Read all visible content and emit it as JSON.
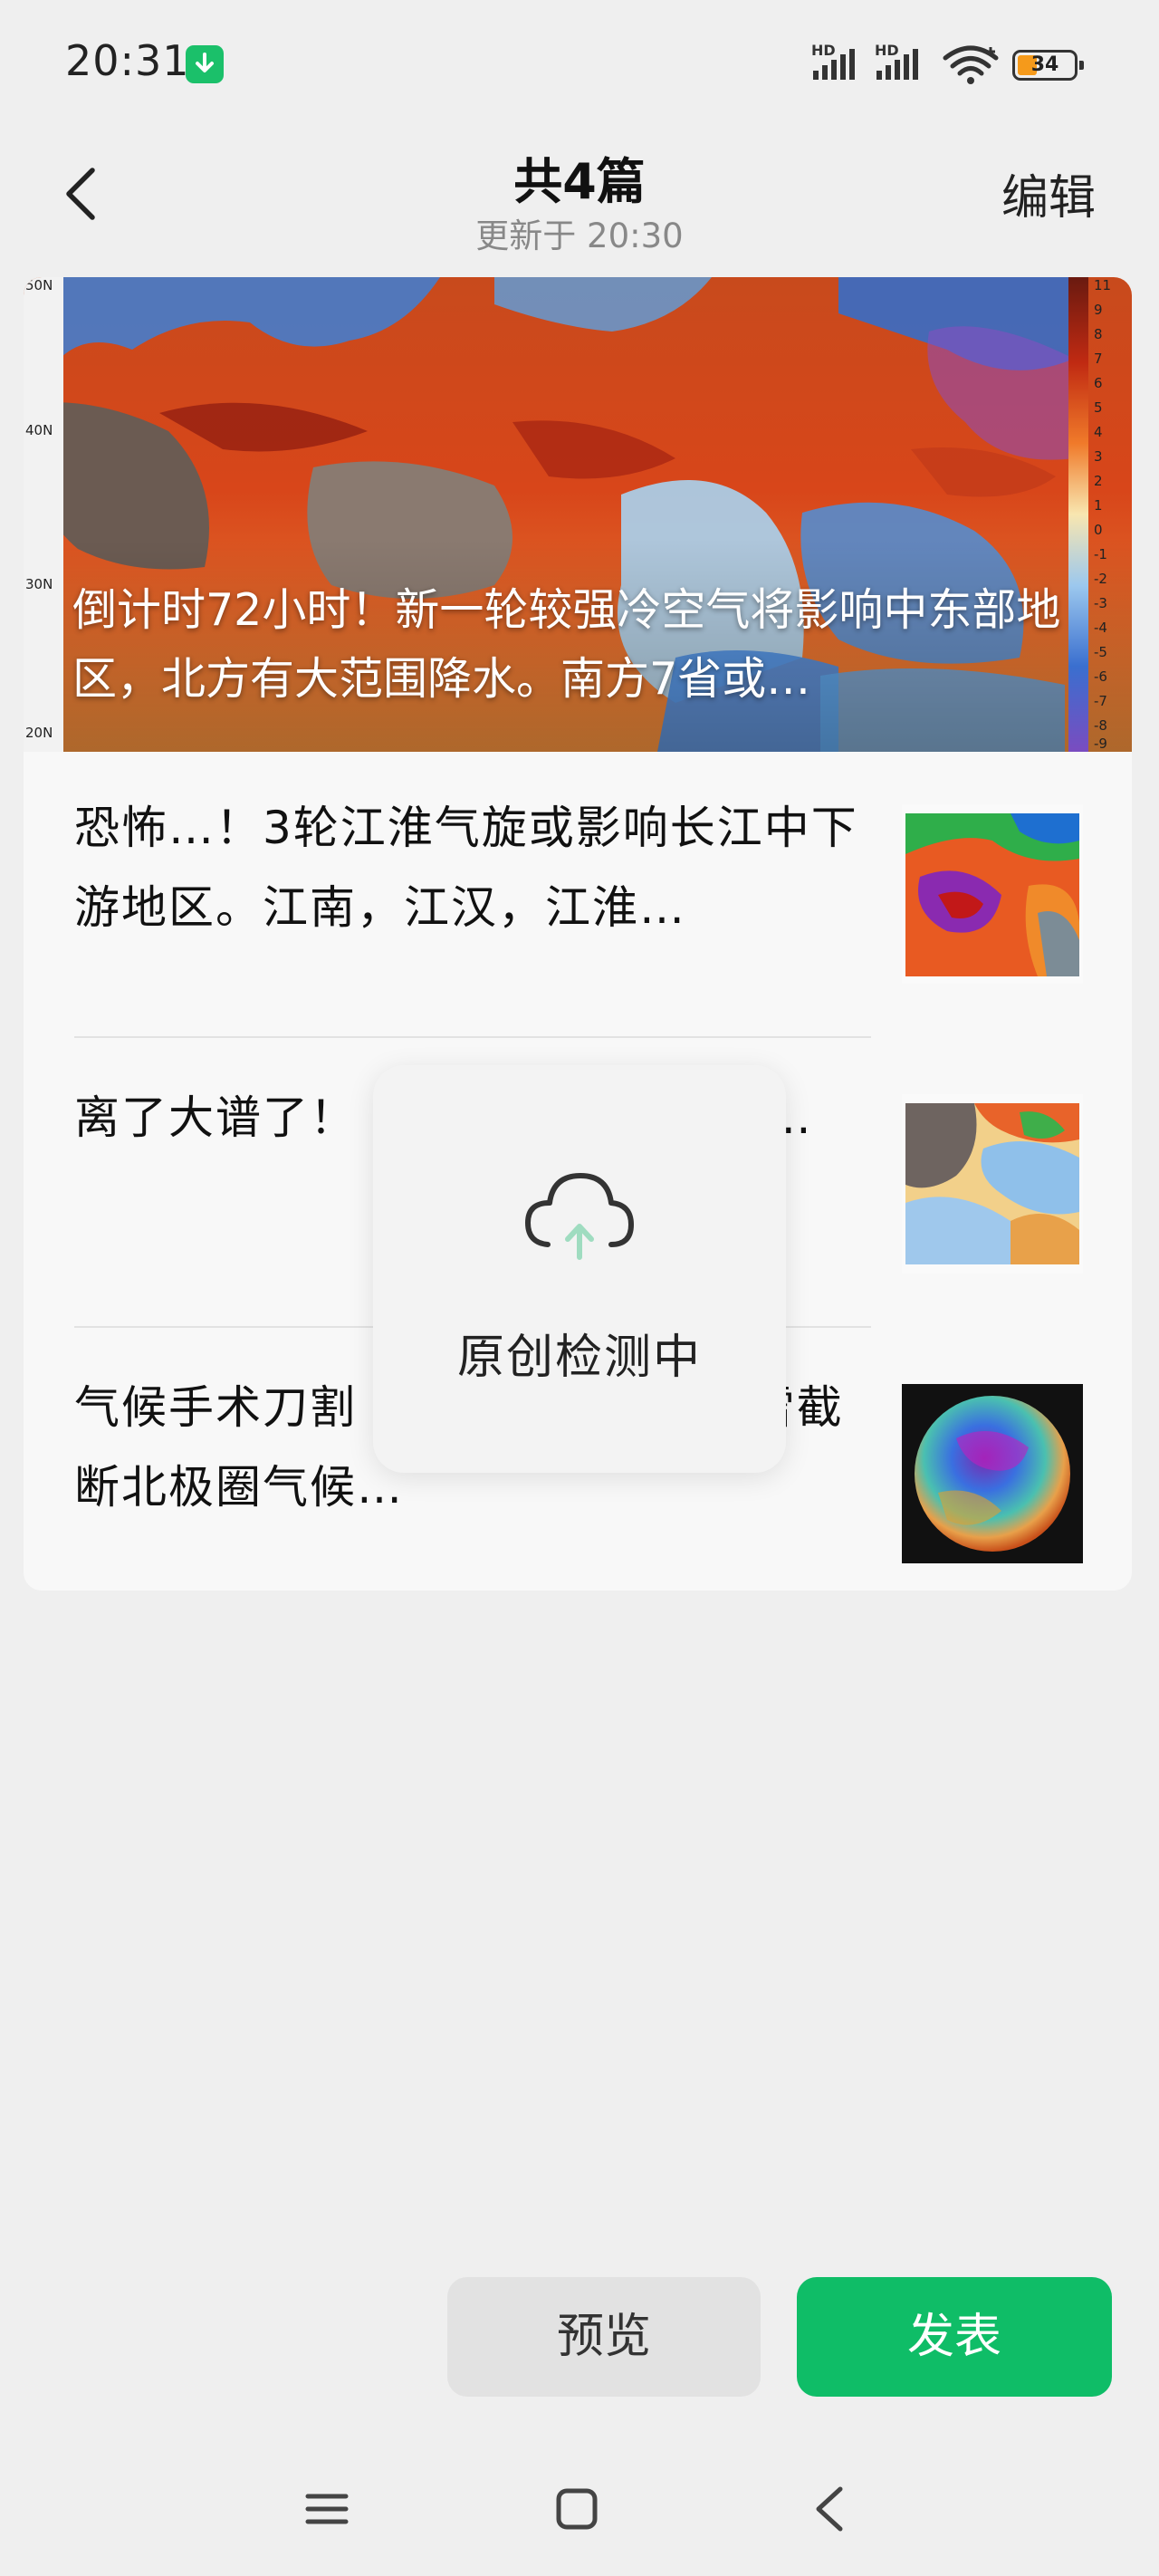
{
  "status_bar": {
    "time": "20:31",
    "signal1_label": "HD",
    "signal2_label": "HD",
    "battery": "34",
    "icons": [
      "download-icon",
      "signal-icon",
      "signal-icon",
      "wifi-icon",
      "battery-icon"
    ]
  },
  "header": {
    "title": "共4篇",
    "subtitle": "更新于 20:30",
    "edit_label": "编辑",
    "back_icon": "chevron-left-icon"
  },
  "hero": {
    "title": "倒计时72小时！新一轮较强冷空气将影响中东部地区，北方有大范围降水。南方7省或…",
    "lat_labels": [
      "50N",
      "40N",
      "30N",
      "20N"
    ],
    "scale_labels": [
      "11",
      "9",
      "8",
      "7",
      "6",
      "5",
      "4",
      "3",
      "2",
      "1",
      "0",
      "-1",
      "-2",
      "-3",
      "-4",
      "-5",
      "-6",
      "-7",
      "-8",
      "-9"
    ]
  },
  "articles": [
    {
      "title": "恐怖…！3轮江淮气旋或影响长江中下游地区。江南，江汉，江淮…",
      "thumb": "weather-map-thumbnail"
    },
    {
      "title": "离了大谱了！              两轮江淮气旋？一                   …",
      "thumb": "weather-map-thumbnail"
    },
    {
      "title": "气候手术刀割                 ，肢解8州 ，欧暴雪截断北极圈气候…",
      "thumb": "globe-thumbnail"
    }
  ],
  "overlay": {
    "text": "原创检测中",
    "icon": "cloud-upload-icon"
  },
  "actions": {
    "preview": "预览",
    "publish": "发表"
  },
  "navbar": {
    "icons": [
      "menu-icon",
      "home-icon",
      "back-icon"
    ]
  },
  "colors": {
    "accent": "#0fbd67",
    "background": "#efefef",
    "card": "#f8f8f8"
  }
}
